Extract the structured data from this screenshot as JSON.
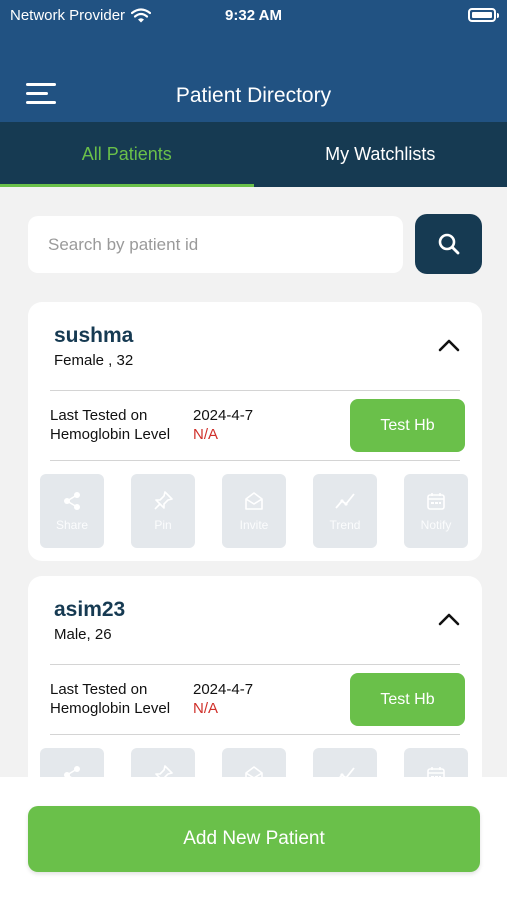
{
  "status_bar": {
    "carrier": "Network Provider",
    "time": "9:32 AM"
  },
  "header": {
    "title": "Patient Directory",
    "menu_icon": "hamburger-menu-icon"
  },
  "tabs": [
    {
      "label": "All Patients",
      "active": true
    },
    {
      "label": "My Watchlists",
      "active": false
    }
  ],
  "search": {
    "placeholder": "Search by patient id",
    "value": "",
    "icon": "search-icon"
  },
  "labels": {
    "last_tested": "Last Tested on",
    "hemoglobin": "Hemoglobin Level",
    "test_button": "Test Hb"
  },
  "action_labels": {
    "share": "Share",
    "pin": "Pin",
    "invite": "Invite",
    "trend": "Trend",
    "notify": "Notify"
  },
  "patients": [
    {
      "name": "sushma",
      "meta": "Female , 32",
      "last_tested": "2024-4-7",
      "hemoglobin": "N/A"
    },
    {
      "name": "asim23",
      "meta": "Male, 26",
      "last_tested": "2024-4-7",
      "hemoglobin": "N/A"
    }
  ],
  "footer": {
    "add_button": "Add New Patient"
  },
  "colors": {
    "header": "#215282",
    "tabs": "#163a52",
    "accent": "#6ac04a",
    "na": "#d0302a"
  }
}
